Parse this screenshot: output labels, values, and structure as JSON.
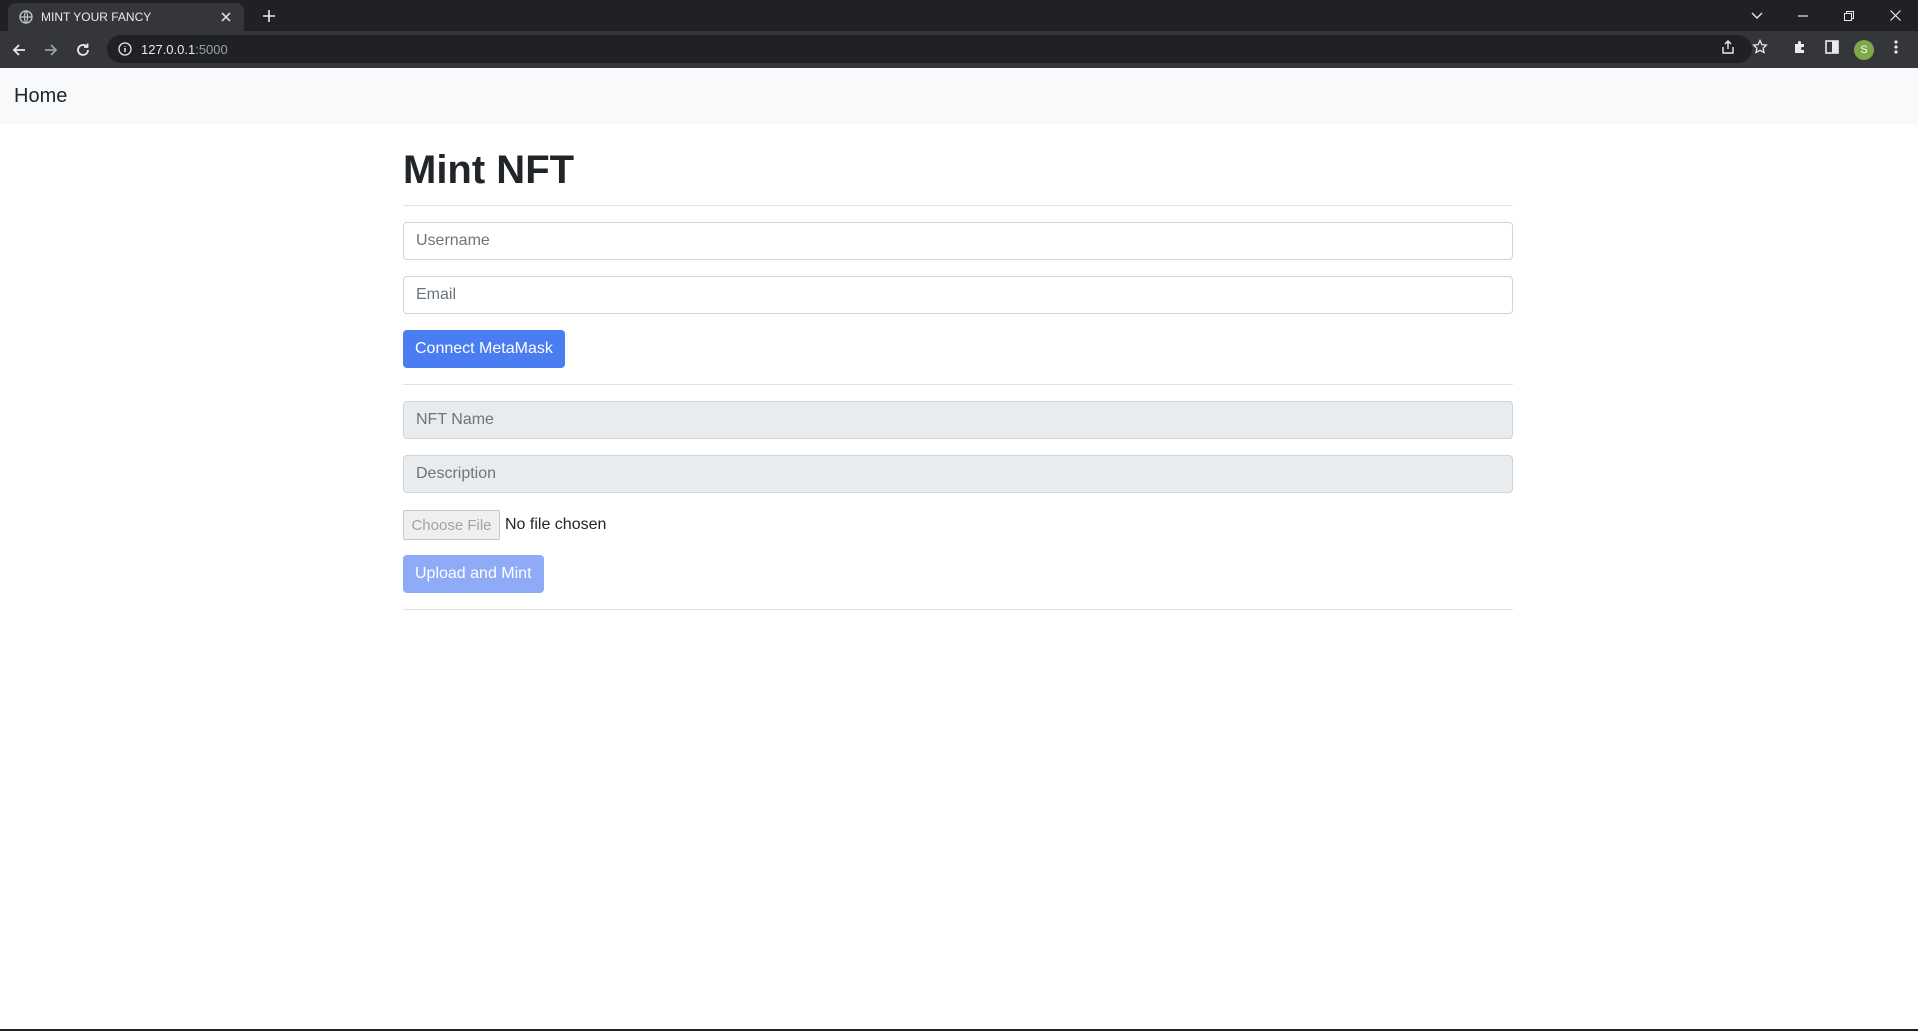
{
  "browser": {
    "tab_title": "MINT YOUR FANCY",
    "url_host": "127.0.0.1",
    "url_port": ":5000",
    "avatar_letter": "S"
  },
  "navbar": {
    "home_label": "Home"
  },
  "main": {
    "title": "Mint NFT",
    "username_placeholder": "Username",
    "email_placeholder": "Email",
    "connect_button": "Connect MetaMask",
    "nft_name_placeholder": "NFT Name",
    "description_placeholder": "Description",
    "file_button": "Choose File",
    "file_status": "No file chosen",
    "mint_button": "Upload and Mint"
  },
  "colors": {
    "primary": "#4a7cf2",
    "primary_disabled": "#8fabf7",
    "navbar_bg": "#f8f9fa",
    "disabled_field_bg": "#e9ecef"
  },
  "icons": [
    "globe-icon",
    "close-icon",
    "plus-icon",
    "chevron-down-icon",
    "minimize-icon",
    "restore-icon",
    "window-close-icon",
    "back-arrow-icon",
    "forward-arrow-icon",
    "reload-icon",
    "info-icon",
    "share-icon",
    "star-icon",
    "extensions-icon",
    "side-panel-icon",
    "more-icon"
  ]
}
